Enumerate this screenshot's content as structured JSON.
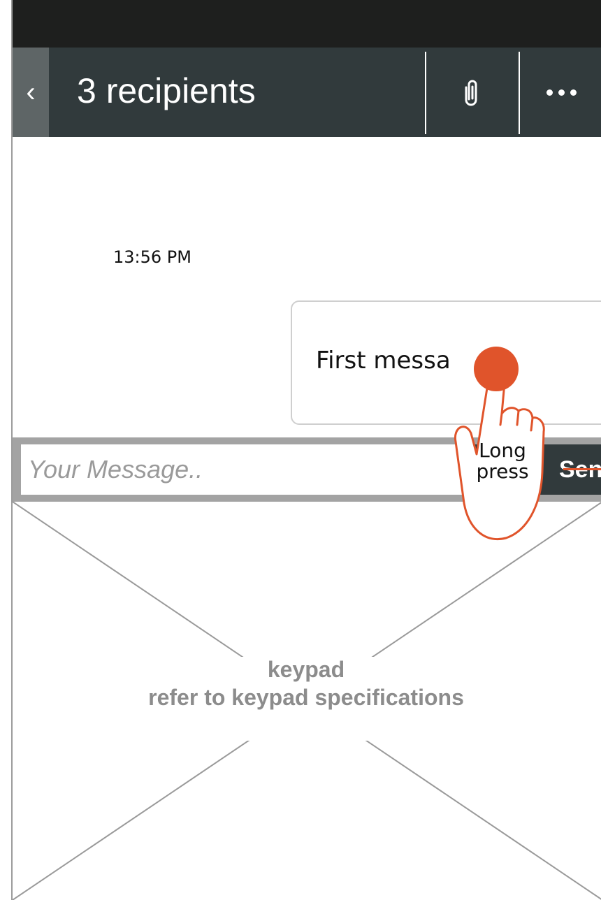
{
  "header": {
    "back_icon": "chevron-left-icon",
    "back_label": "‹",
    "title": "3 recipients",
    "attach_icon": "paperclip-icon",
    "more_icon": "more-dots-icon"
  },
  "conversation": {
    "timestamp": "13:56 PM",
    "messages": [
      {
        "text": "First messa"
      }
    ]
  },
  "composer": {
    "placeholder": "Your Message..",
    "send_label": "Send"
  },
  "keypad": {
    "title": "keypad",
    "note": "refer to keypad specifications"
  },
  "gesture": {
    "label_line1": "Long",
    "label_line2": "press",
    "accent_color": "#e0542b"
  }
}
